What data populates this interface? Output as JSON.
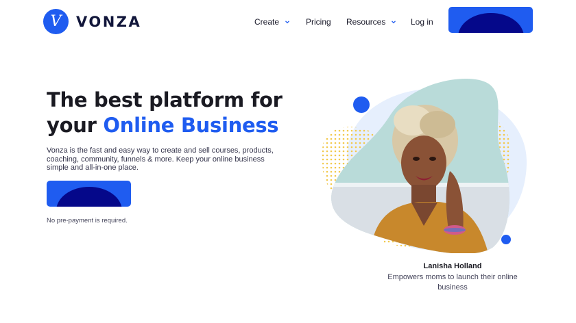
{
  "brand": {
    "mark": "V",
    "name": "VONZA"
  },
  "nav": {
    "items": [
      {
        "label": "Create",
        "has_dropdown": true,
        "icon": "chevron-down-icon"
      },
      {
        "label": "Pricing",
        "has_dropdown": false
      },
      {
        "label": "Resources",
        "has_dropdown": true,
        "icon": "chevron-down-icon"
      },
      {
        "label": "Log in",
        "has_dropdown": false
      }
    ],
    "cta_label": ""
  },
  "hero": {
    "headline_line1": "The best platform for",
    "headline_line2_prefix": "your",
    "headline_line2_accent": "Online Business",
    "description": "Vonza is the fast and easy way to create and sell courses, products, coaching, community, funnels & more. Keep your online business simple and all-in-one place.",
    "cta_label": "",
    "note": "No pre-payment is required."
  },
  "testimonial": {
    "name": "Lanisha Holland",
    "description": "Empowers moms to launch their online business"
  },
  "colors": {
    "accent": "#1f5cf0",
    "button_blob": "#05088a",
    "dots": "#f2c94c",
    "pale_blob": "#e6effd",
    "headline_text": "#1a1a22"
  }
}
